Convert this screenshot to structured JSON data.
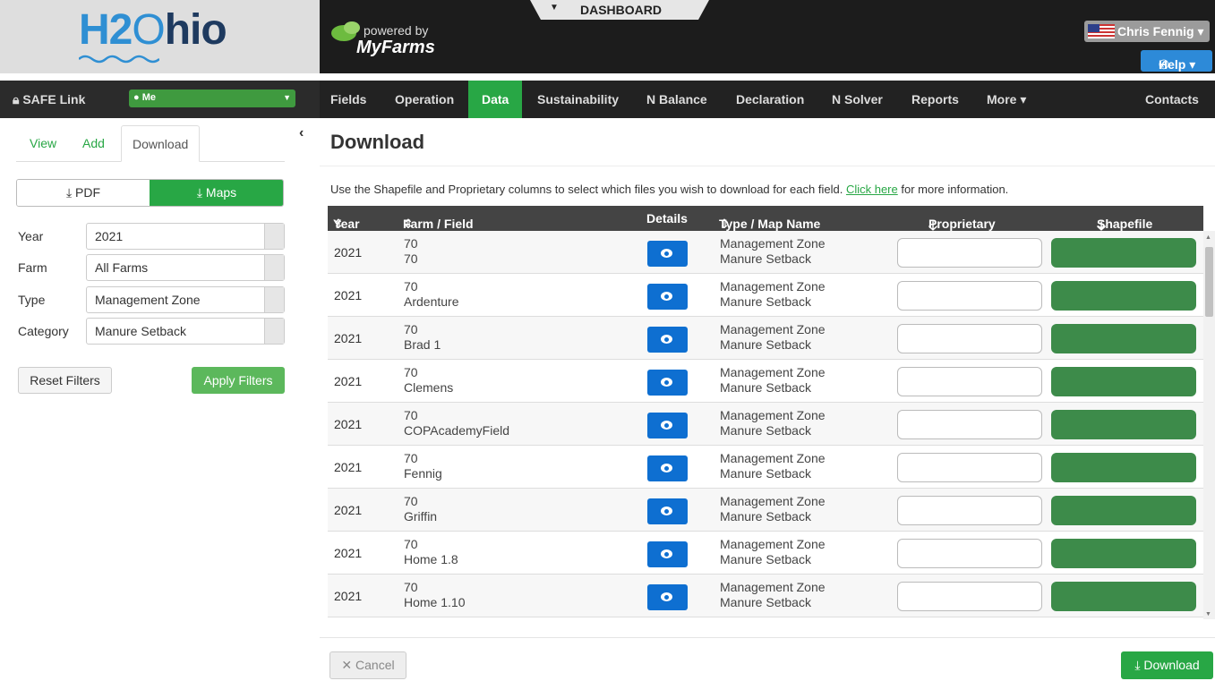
{
  "header": {
    "logo_h2": "H2",
    "logo_o": "O",
    "logo_hio": "hio",
    "powered_by": "powered by",
    "brand": "MyFarms",
    "dashboard_label": "DASHBOARD",
    "user_name": "Chris Fennig ▾",
    "help_label": "Help ▾"
  },
  "navbar": {
    "safe_link": "SAFE Link",
    "me_select": "Me",
    "items": [
      "Fields",
      "Operation",
      "Data",
      "Sustainability",
      "N Balance",
      "Declaration",
      "N Solver",
      "Reports",
      "More ▾",
      "Contacts"
    ],
    "active": "Data"
  },
  "sidebar": {
    "tabs": [
      "View",
      "Add",
      "Download"
    ],
    "active_tab": "Download",
    "pdf_label": "PDF",
    "maps_label": "Maps",
    "filters": [
      {
        "label": "Year",
        "value": "2021"
      },
      {
        "label": "Farm",
        "value": "All Farms"
      },
      {
        "label": "Type",
        "value": "Management Zone"
      },
      {
        "label": "Category",
        "value": "Manure Setback"
      }
    ],
    "reset_label": "Reset Filters",
    "apply_label": "Apply Filters"
  },
  "main": {
    "title": "Download",
    "intro_before": "Use the Shapefile and Proprietary columns to select which files you wish to download for each field.",
    "intro_link": "Click here",
    "intro_after": "for more information.",
    "columns": [
      "Year",
      "Farm / Field",
      "Details",
      "Type / Map Name",
      "Proprietary",
      "Shapefile"
    ],
    "rows": [
      {
        "year": "2021",
        "farm": "70",
        "field": "70",
        "type": "Management Zone",
        "map": "Manure Setback"
      },
      {
        "year": "2021",
        "farm": "70",
        "field": "Ardenture",
        "type": "Management Zone",
        "map": "Manure Setback"
      },
      {
        "year": "2021",
        "farm": "70",
        "field": "Brad 1",
        "type": "Management Zone",
        "map": "Manure Setback"
      },
      {
        "year": "2021",
        "farm": "70",
        "field": "Clemens",
        "type": "Management Zone",
        "map": "Manure Setback"
      },
      {
        "year": "2021",
        "farm": "70",
        "field": "COPAcademyField",
        "type": "Management Zone",
        "map": "Manure Setback"
      },
      {
        "year": "2021",
        "farm": "70",
        "field": "Fennig",
        "type": "Management Zone",
        "map": "Manure Setback"
      },
      {
        "year": "2021",
        "farm": "70",
        "field": "Griffin",
        "type": "Management Zone",
        "map": "Manure Setback"
      },
      {
        "year": "2021",
        "farm": "70",
        "field": "Home 1.8",
        "type": "Management Zone",
        "map": "Manure Setback"
      },
      {
        "year": "2021",
        "farm": "70",
        "field": "Home 1.10",
        "type": "Management Zone",
        "map": "Manure Setback"
      }
    ],
    "cancel_label": "Cancel",
    "download_label": "Download"
  },
  "colors": {
    "accent": "#28a745",
    "nav_bg": "#222222",
    "details_button": "#0e6fd1",
    "shapefile_cell": "#3d8b4a"
  }
}
